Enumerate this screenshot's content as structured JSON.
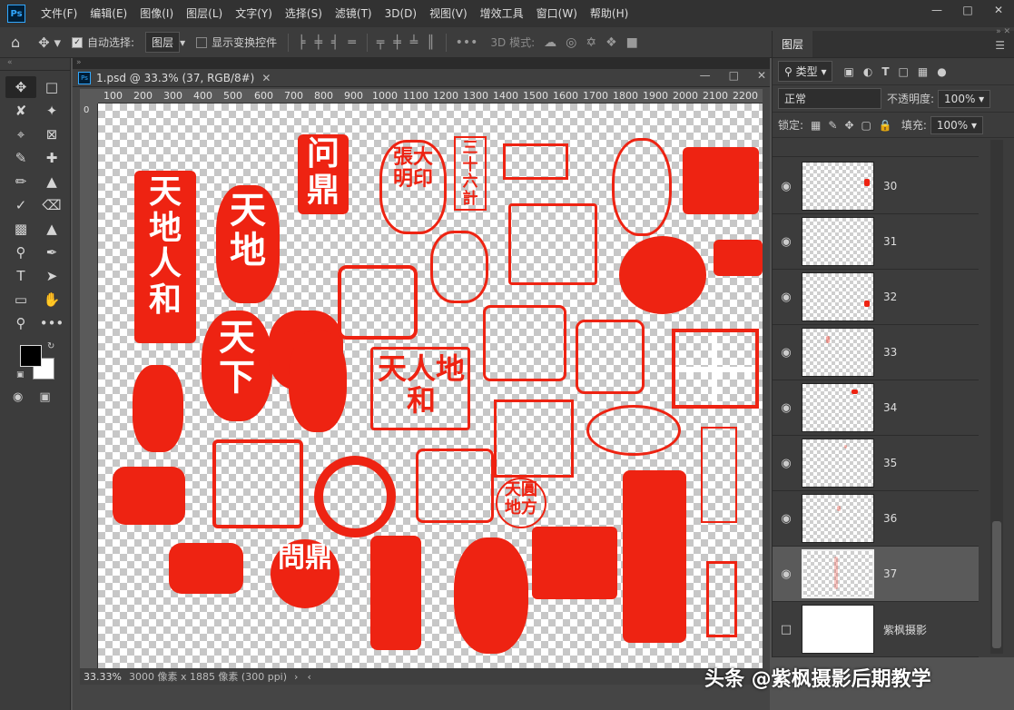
{
  "app": {
    "logo": "Ps"
  },
  "menus": [
    "文件(F)",
    "编辑(E)",
    "图像(I)",
    "图层(L)",
    "文字(Y)",
    "选择(S)",
    "滤镜(T)",
    "3D(D)",
    "视图(V)",
    "增效工具",
    "窗口(W)",
    "帮助(H)"
  ],
  "options": {
    "auto_select_label": "自动选择:",
    "auto_select_value": "图层",
    "show_transform_label": "显示变换控件",
    "mode3d_label": "3D 模式:"
  },
  "document": {
    "tab_title": "1.psd @ 33.3% (37, RGB/8#)",
    "ruler_ticks": [
      "100",
      "200",
      "300",
      "400",
      "500",
      "600",
      "700",
      "800",
      "900",
      "1000",
      "1100",
      "1200",
      "1300",
      "1400",
      "1500",
      "1600",
      "1700",
      "1800",
      "1900",
      "2000",
      "2100",
      "2200"
    ],
    "ruler_zero": "0",
    "zoom": "33.33%",
    "status_info": "3000 像素 x 1885 像素 (300 ppi)"
  },
  "seal_texts": {
    "s1": "天地人和",
    "s2": "天地",
    "s3": "问鼎",
    "s4": "張大明印",
    "s5": "三十六計",
    "s6": "天下",
    "s7": "天人地和",
    "s8": "天圓地方",
    "s9": "問鼎"
  },
  "layers_panel": {
    "tab_label": "图层",
    "filter_label": "类型",
    "blend_mode": "正常",
    "opacity_label": "不透明度:",
    "opacity_value": "100%",
    "lock_label": "锁定:",
    "fill_label": "填充:",
    "fill_value": "100%",
    "layers": [
      {
        "name": "30"
      },
      {
        "name": "31"
      },
      {
        "name": "32"
      },
      {
        "name": "33"
      },
      {
        "name": "34"
      },
      {
        "name": "35"
      },
      {
        "name": "36"
      },
      {
        "name": "37"
      },
      {
        "name": "紫枫摄影"
      }
    ]
  },
  "watermark": "头条 @紫枫摄影后期教学",
  "colors": {
    "seal_red": "#ee2312",
    "accent": "#31a8ff"
  }
}
